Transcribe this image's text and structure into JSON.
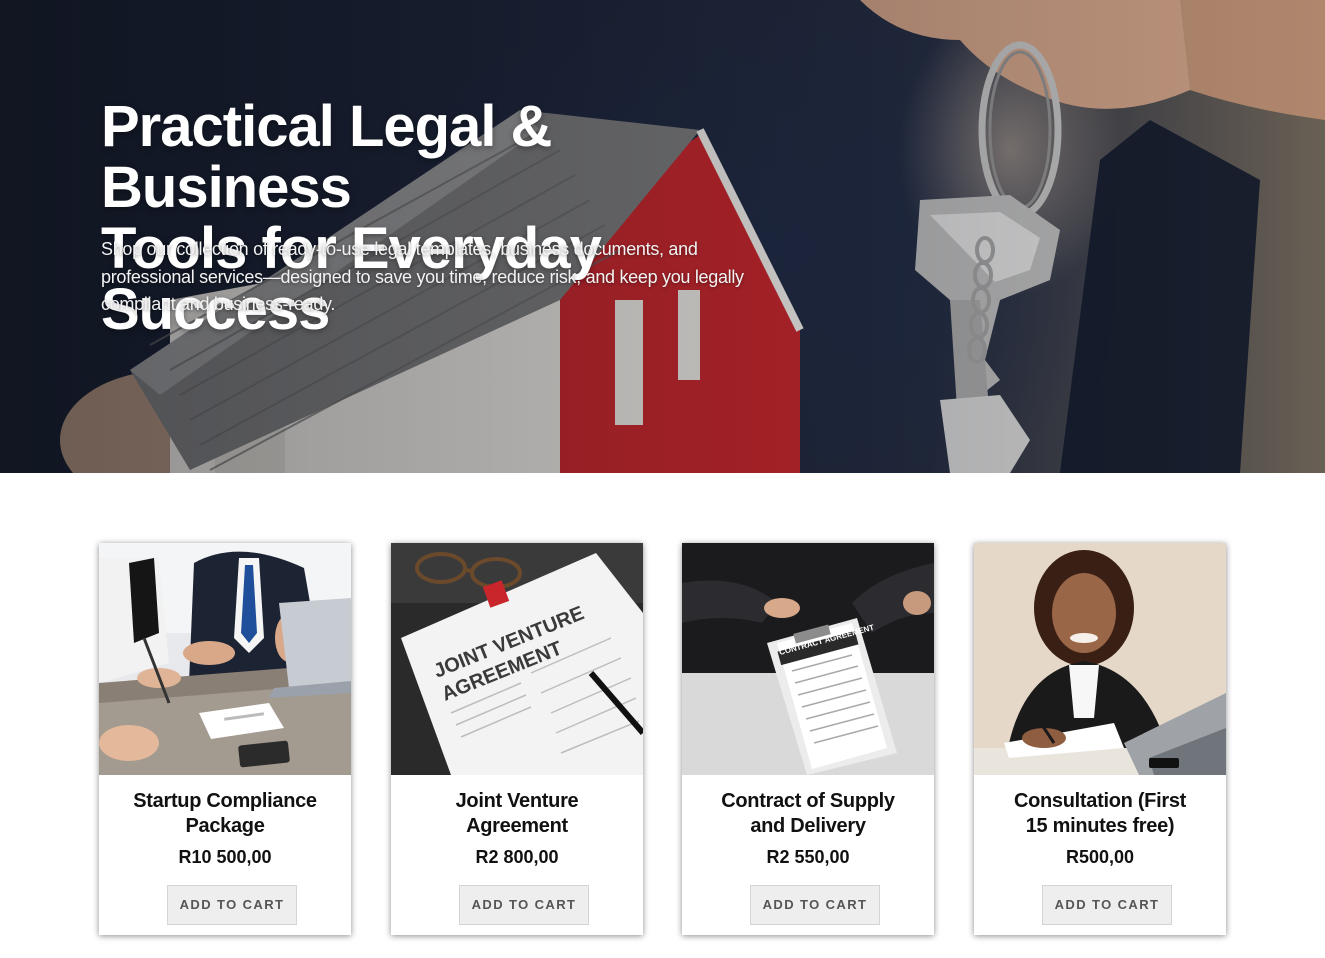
{
  "hero": {
    "title_line1": "Practical Legal & Business",
    "title_line2": "Tools for Everyday Success",
    "subtitle": "Shop our collection of ready-to-use legal templates, business documents, and professional services—designed to save you time, reduce risk, and keep you legally compliant and business-ready."
  },
  "products": [
    {
      "name": "Startup Compliance Package",
      "price": "R10 500,00",
      "button": "ADD TO CART"
    },
    {
      "name": "Joint Venture Agreement",
      "price": "R2 800,00",
      "button": "ADD TO CART"
    },
    {
      "name": "Contract of Supply and Delivery",
      "price": "R2 550,00",
      "button": "ADD TO CART"
    },
    {
      "name": "Consultation (First 15 minutes free)",
      "price": "R500,00",
      "button": "ADD TO CART"
    }
  ],
  "images": {
    "p2_doc_line1": "JOINT VENTURE",
    "p2_doc_line2": "AGREEMENT",
    "p3_doc_title": "CONTRACT AGREEMENT"
  },
  "colors": {
    "hero_bg": "#1c2438",
    "house_red": "#c8262b",
    "button_bg": "#eeeeee",
    "text_dark": "#111111"
  }
}
